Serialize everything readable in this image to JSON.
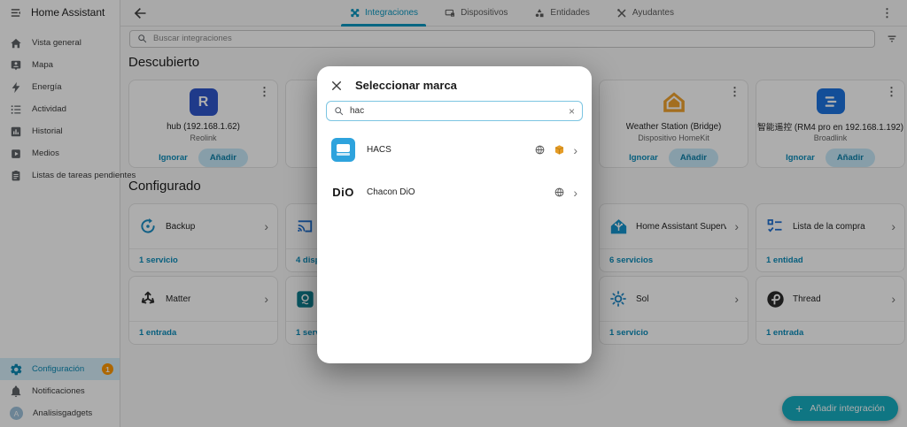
{
  "app": {
    "title": "Home Assistant"
  },
  "glyphs": {
    "kebab": "⋮",
    "chevron": "›",
    "clear": "×",
    "plus": "+"
  },
  "sidebar": {
    "items": [
      {
        "label": "Vista general"
      },
      {
        "label": "Mapa"
      },
      {
        "label": "Energía"
      },
      {
        "label": "Actividad"
      },
      {
        "label": "Historial"
      },
      {
        "label": "Medios"
      },
      {
        "label": "Listas de tareas pendientes"
      }
    ],
    "config": {
      "label": "Configuración",
      "badge": "1"
    },
    "notifications": {
      "label": "Notificaciones"
    },
    "user": {
      "label": "Analisisgadgets",
      "initial": "A"
    }
  },
  "topbar": {
    "tabs": [
      {
        "label": "Integraciones"
      },
      {
        "label": "Dispositivos"
      },
      {
        "label": "Entidades"
      },
      {
        "label": "Ayudantes"
      }
    ]
  },
  "search": {
    "placeholder": "Buscar integraciones"
  },
  "sections": {
    "discovered": "Descubierto",
    "configured": "Configurado"
  },
  "discovered": [
    {
      "title": "hub (192.168.1.62)",
      "subtitle": "Reolink",
      "ignore": "Ignorar",
      "add": "Añadir",
      "logo_letter": "R"
    },
    {
      "title": "Weather Station (Bridge)",
      "subtitle": "Dispositivo HomeKit",
      "ignore": "Ignorar",
      "add": "Añadir"
    },
    {
      "title": "智能遥控 (RM4 pro en 192.168.1.192)",
      "subtitle": "Broadlink",
      "ignore": "Ignorar",
      "add": "Añadir"
    }
  ],
  "configured": [
    {
      "name": "Backup",
      "link": "1 servicio"
    },
    {
      "name": "",
      "link": "4 dispositivos"
    },
    {
      "name": "Home Assistant Supervisor",
      "link": "6 servicios"
    },
    {
      "name": "Lista de la compra",
      "link": "1 entidad"
    },
    {
      "name": "Matter",
      "link": "1 entrada"
    },
    {
      "name": "",
      "link": "1 servicio"
    },
    {
      "name": "Sol",
      "link": "1 servicio"
    },
    {
      "name": "Thread",
      "link": "1 entrada"
    }
  ],
  "modal": {
    "title": "Seleccionar marca",
    "search_value": "hac",
    "items": [
      {
        "name": "HACS"
      },
      {
        "name": "Chacon DiO",
        "logo_text": "DiO"
      }
    ]
  },
  "fab": {
    "label": "Añadir integración"
  },
  "colors": {
    "accent": "#0a97c0",
    "badge": "#ff9800",
    "fab": "#17aec1"
  }
}
